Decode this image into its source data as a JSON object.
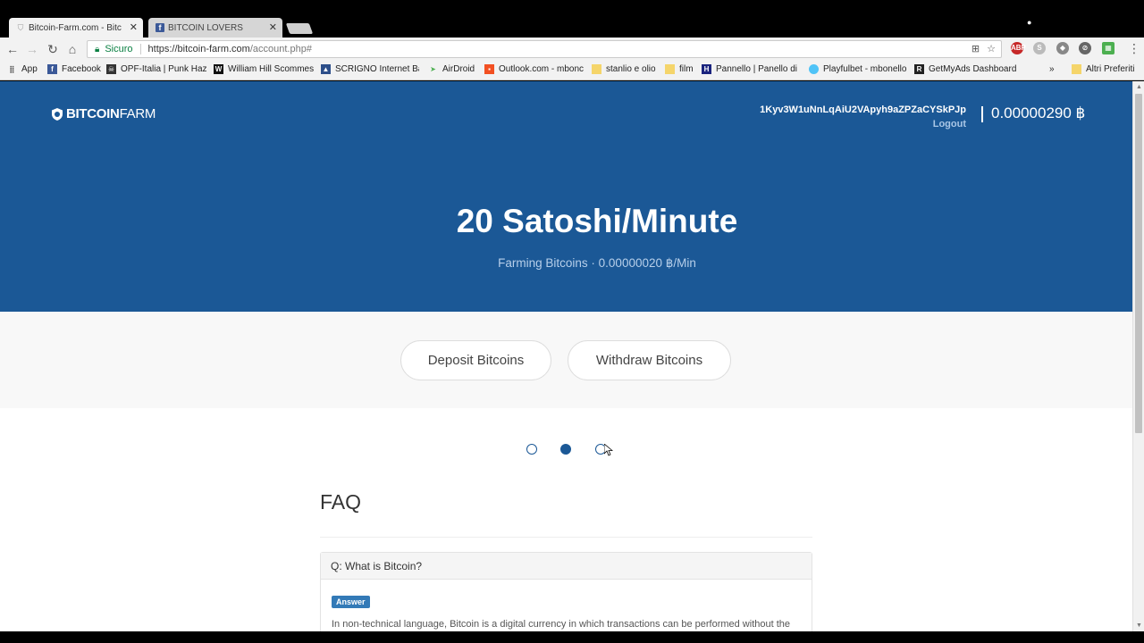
{
  "browser": {
    "tabs": [
      {
        "title": "Bitcoin-Farm.com - Bitcoin",
        "active": true
      },
      {
        "title": "BITCOIN LOVERS",
        "active": false
      }
    ],
    "address_bar": {
      "secure_label": "Sicuro",
      "url_host": "https://bitcoin-farm.com",
      "url_path": "/account.php#"
    },
    "bookmarks": [
      {
        "label": "App",
        "icon": "apps-grid-icon"
      },
      {
        "label": "Facebook",
        "icon": "facebook-icon"
      },
      {
        "label": "OPF-Italia | Punk Haza",
        "icon": "opf-icon"
      },
      {
        "label": "William Hill Scommes",
        "icon": "william-hill-icon"
      },
      {
        "label": "SCRIGNO Internet Ba",
        "icon": "scrigno-icon"
      },
      {
        "label": "AirDroid",
        "icon": "airdroid-icon"
      },
      {
        "label": "Outlook.com - mbonc",
        "icon": "outlook-icon"
      },
      {
        "label": "stanlio e olio",
        "icon": "folder-icon"
      },
      {
        "label": "film",
        "icon": "folder-icon"
      },
      {
        "label": "Pannello | Panello di c",
        "icon": "pannello-icon"
      },
      {
        "label": "Playfulbet - mbonello",
        "icon": "playfulbet-icon"
      },
      {
        "label": "GetMyAds Dashboard",
        "icon": "getmyads-icon"
      },
      {
        "label": "»",
        "icon": "overflow-chevron-icon"
      },
      {
        "label": "Altri Preferiti",
        "icon": "folder-icon"
      }
    ]
  },
  "site": {
    "logo_bold": "BITCOIN",
    "logo_light": "FARM",
    "wallet_address": "1Kyv3W1uNnLqAiU2VApyh9aZPZaCYSkPJp",
    "logout_label": "Logout",
    "balance": "0.00000290 ฿",
    "rate_title": "20 Satoshi/Minute",
    "rate_subtitle": "Farming Bitcoins · 0.00000020 ฿/Min",
    "deposit_label": "Deposit Bitcoins",
    "withdraw_label": "Withdraw Bitcoins",
    "faq_title": "FAQ",
    "faq_question": "Q: What is Bitcoin?",
    "answer_badge": "Answer",
    "faq_answer": "In non-technical language, Bitcoin is a digital currency in which transactions can be performed without the"
  },
  "colors": {
    "brand_blue": "#1b5896",
    "secure_green": "#0b8043"
  }
}
